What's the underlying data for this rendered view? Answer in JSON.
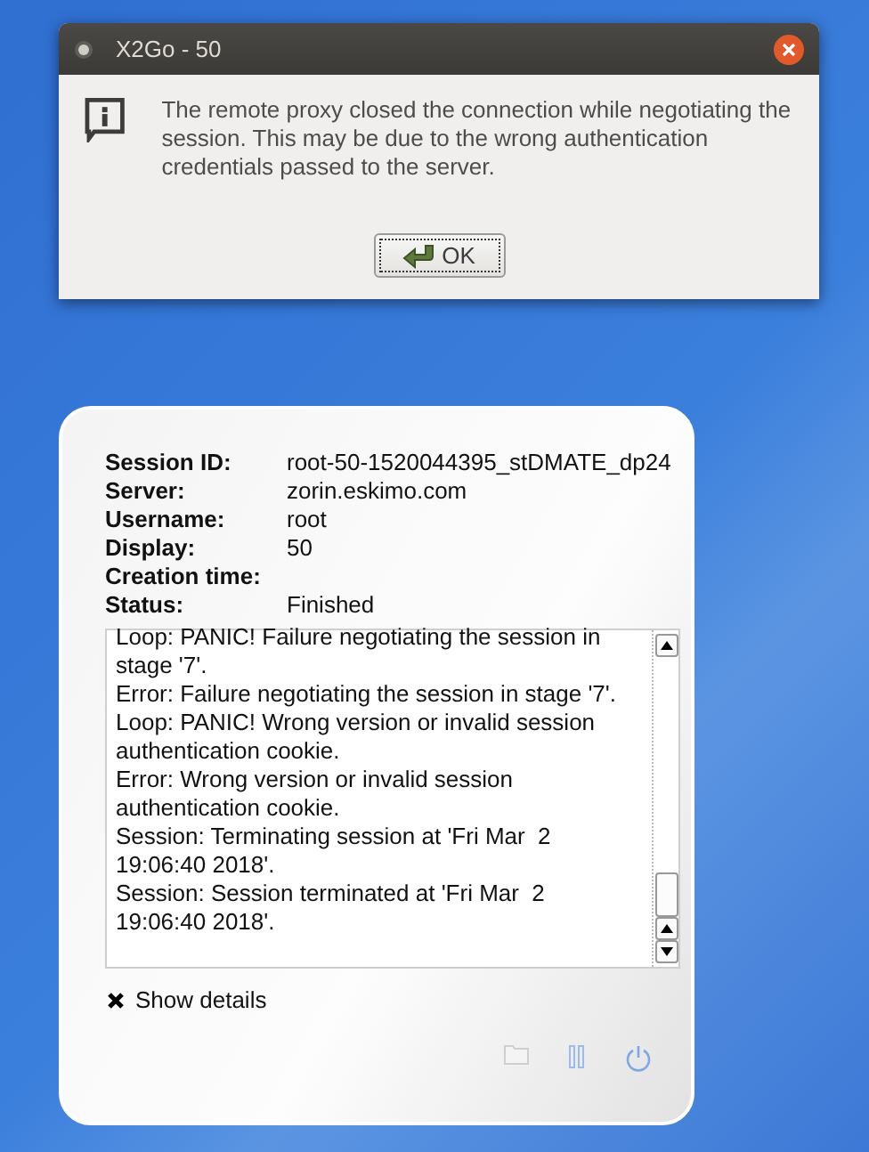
{
  "dialog": {
    "title": "X2Go - 50",
    "message": "The remote proxy closed the connection while negotiating the session. This may be due to the wrong authentication credentials passed to the server.",
    "button": "OK"
  },
  "session": {
    "fields": [
      {
        "label": "Session ID:",
        "value": "root-50-1520044395_stDMATE_dp24"
      },
      {
        "label": "Server:",
        "value": "zorin.eskimo.com"
      },
      {
        "label": "Username:",
        "value": "root"
      },
      {
        "label": "Display:",
        "value": "50"
      },
      {
        "label": "Creation time:"
      },
      {
        "label": "Status:",
        "value": "Finished"
      }
    ],
    "log": [
      "Loop: PANIC! Failure negotiating the session in",
      "stage '7'.",
      "Error: Failure negotiating the session in stage '7'.",
      "Loop: PANIC! Wrong version or invalid session",
      "authentication cookie.",
      "Error: Wrong version or invalid session",
      "authentication cookie.",
      "Session: Terminating session at 'Fri Mar  2",
      "19:06:40 2018'.",
      "Session: Session terminated at 'Fri Mar  2",
      "19:06:40 2018'."
    ],
    "show_details": {
      "label": "Show details",
      "checked": true
    }
  }
}
